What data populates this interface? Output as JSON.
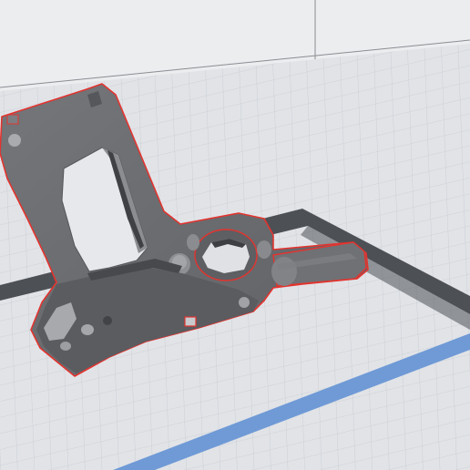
{
  "app": {
    "view": "3d-slicer-build-plate-preview"
  },
  "colors": {
    "background": "#ecedef",
    "plate": "#e0e2e6",
    "grid_minor": "#c7cbd1",
    "grid_major": "#a9afb8",
    "plate_border": "#4a4d52",
    "volume_edge": "#8a8d92",
    "model_body": "#6c6e72",
    "model_dark": "#4e5054",
    "model_light": "#9a9ca0",
    "model_outline": "#e3342f",
    "axis_indicator": "#6f9ad6"
  },
  "icons": {
    "axis": "axis-bar-icon"
  }
}
